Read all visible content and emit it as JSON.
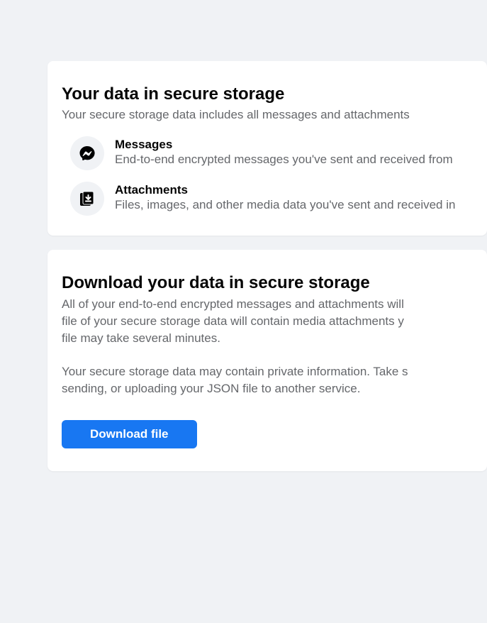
{
  "card1": {
    "title": "Your data in secure storage",
    "subtitle": "Your secure storage data includes all messages and attachments",
    "items": [
      {
        "title": "Messages",
        "desc": "End-to-end encrypted messages you've sent and received from"
      },
      {
        "title": "Attachments",
        "desc": "Files, images, and other media data you've sent and received in"
      }
    ]
  },
  "card2": {
    "title": "Download your data in secure storage",
    "para1_l1": "All of your end-to-end encrypted messages and attachments will",
    "para1_l2": "file of your secure storage data will contain media attachments y",
    "para1_l3": "file may take several minutes.",
    "para2_l1": "Your secure storage data may contain private information. Take s",
    "para2_l2": "sending, or uploading your JSON file to another service.",
    "button": "Download file"
  }
}
